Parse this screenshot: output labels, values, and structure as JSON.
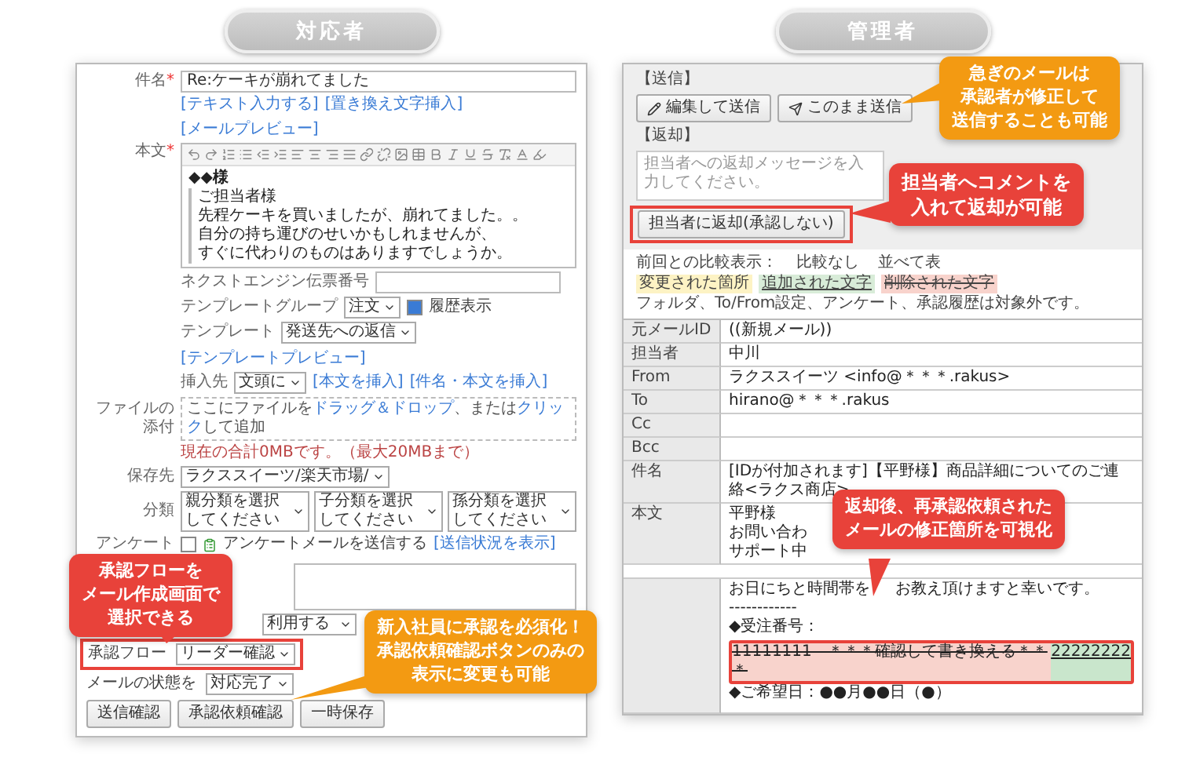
{
  "left": {
    "header": "対応者",
    "subject": {
      "label": "件名",
      "required_mark": "*",
      "value": "Re:ケーキが崩れてました"
    },
    "editor_links": [
      "[テキスト入力する]",
      "[置き換え文字挿入]",
      "[メールプレビュー]"
    ],
    "body": {
      "label": "本文",
      "required_mark": "*",
      "greeting": "◆◆様",
      "quote": [
        "ご担当者様",
        "先程ケーキを買いましたが、崩れてました。。",
        "自分の持ち運びのせいかもしれませんが、",
        "すぐに代わりのものはありますでしょうか。"
      ]
    },
    "fields": [
      {
        "kind": "input",
        "label": "ネクストエンジン伝票番号"
      },
      {
        "kind": "select",
        "label": "テンプレートグループ",
        "value": "注文",
        "checkbox": {
          "label": "履歴表示",
          "checked": true
        }
      },
      {
        "kind": "select",
        "label": "テンプレート",
        "value": "発送先への返信",
        "links": [
          "[テンプレートプレビュー]"
        ]
      },
      {
        "kind": "select",
        "label": "挿入先",
        "value": "文頭に",
        "links": [
          "[本文を挿入]",
          "[件名・本文を挿入]"
        ]
      }
    ],
    "attach": {
      "label": "ファイルの添付",
      "drop_text": "ここにファイルを**ドラッグ＆ドロップ**、または**クリック**して追加",
      "note": "現在の合計0MBです。（最大20MBまで）"
    },
    "save": {
      "label": "保存先",
      "value": "ラクススイーツ/楽天市場/"
    },
    "category": {
      "label": "分類",
      "selects": [
        "親分類を選択してください",
        "子分類を選択してください",
        "孫分類を選択してください"
      ]
    },
    "survey": {
      "label": "アンケート",
      "checked": false,
      "text": "アンケートメールを送信する",
      "link": "[送信状況を表示]"
    },
    "usage": {
      "value": "利用する"
    },
    "approval": {
      "label": "承認フロー",
      "value": "リーダー確認",
      "highlighted": true
    },
    "status": {
      "label": "メールの状態を",
      "value": "対応完了"
    },
    "buttons": [
      "送信確認",
      "承認依頼確認",
      "一時保存"
    ]
  },
  "right": {
    "header": "管理者",
    "send_label": "【送信】",
    "send_buttons": [
      {
        "kind": "edit",
        "label": "編集して送信"
      },
      {
        "kind": "send",
        "label": "このまま送信"
      }
    ],
    "return_label": "【返却】",
    "return_placeholder": "担当者への返却メッセージを入力してください。",
    "return_button": {
      "label": "担当者に返却(承認しない)",
      "highlighted": true
    },
    "compare": {
      "label": "前回との比較表示：",
      "options": [
        "比較なし",
        "並べて表"
      ]
    },
    "legend": [
      {
        "kind": "changed",
        "text": "変更された箇所"
      },
      {
        "kind": "added",
        "text": "追加された文字"
      },
      {
        "kind": "deleted",
        "text": "削除された文字"
      }
    ],
    "legend_note": "フォルダ、To/From設定、アンケート、承認履歴は対象外です。",
    "rows": [
      {
        "label": "元メールID",
        "value": "((新規メール))"
      },
      {
        "label": "担当者",
        "value": "中川"
      },
      {
        "label": "From",
        "value": "ラクススイーツ <info@＊＊＊.rakus>"
      },
      {
        "label": "To",
        "value": "hirano@＊＊＊.rakus"
      },
      {
        "label": "Cc"
      },
      {
        "label": "Bcc"
      },
      {
        "label": "件名",
        "value": "[IDが付加されます]【平野様】商品詳細についてのご連絡<ラクス商店>"
      }
    ],
    "body_label": "本文",
    "body_lines": [
      "平野様",
      "お問い合わ",
      "サポート中"
    ],
    "detail_lines": [
      "お日にちと時間帯を",
      "お教え頂けますと幸いです。",
      "------------"
    ],
    "diff": {
      "label": "◆受注番号：",
      "highlighted": true,
      "parts": [
        {
          "kind": "deleted",
          "text": "11111111　＊＊＊確認して書き換える＊＊＊"
        },
        {
          "kind": "added",
          "text": "22222222"
        }
      ]
    },
    "last_line": "◆ご希望日：●●月●●日（●）"
  },
  "callouts": [
    {
      "lines": [
        "承認フローを",
        "メール作成画面で",
        "選択できる"
      ],
      "color": "#e8423a"
    },
    {
      "lines": [
        "新入社員に承認を必須化！",
        "承認依頼確認ボタンのみの",
        "表示に変更も可能"
      ],
      "color": "#f39a12"
    },
    {
      "lines": [
        "急ぎのメールは",
        "承認者が修正して",
        "送信することも可能"
      ],
      "color": "#f39a12"
    },
    {
      "lines": [
        "担当者へコメントを",
        "入れて返却が可能"
      ],
      "color": "#e8423a"
    },
    {
      "lines": [
        "返却後、再承認依頼された",
        "メールの修正箇所を可視化"
      ],
      "color": "#e8423a"
    }
  ]
}
